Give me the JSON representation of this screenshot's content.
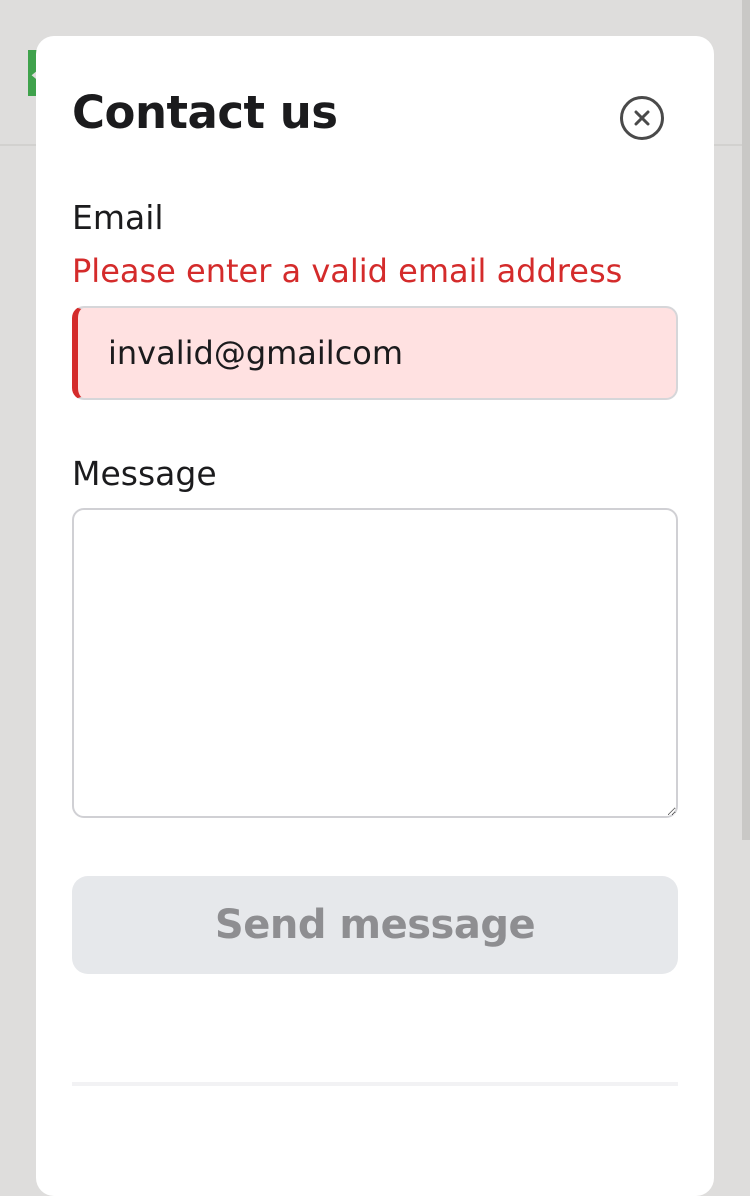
{
  "modal": {
    "title": "Contact us",
    "close_icon": "close-circle-icon"
  },
  "form": {
    "email": {
      "label": "Email",
      "error": "Please enter a valid email address",
      "value": "invalid@gmailcom"
    },
    "message": {
      "label": "Message",
      "value": ""
    },
    "send_label": "Send message"
  },
  "colors": {
    "error": "#d42b2b",
    "error_background": "#ffe1e1",
    "disabled_button_bg": "#e6e8eb",
    "disabled_button_text": "#8e8e91",
    "background_accent": "#3fa24c"
  }
}
